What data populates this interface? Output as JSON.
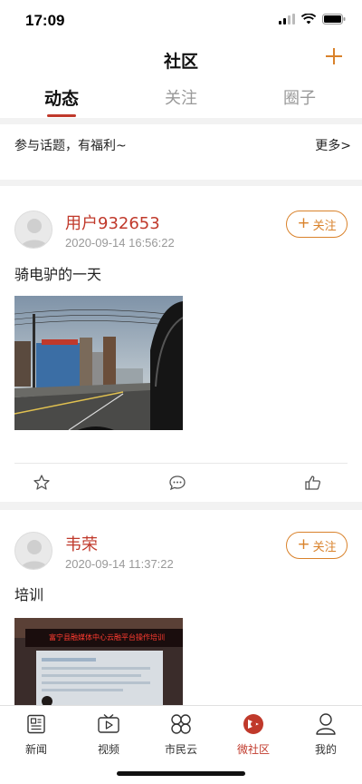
{
  "status_bar": {
    "time": "17:09"
  },
  "nav": {
    "title": "社区",
    "add_icon": "plus-icon"
  },
  "tabs": [
    {
      "label": "动态",
      "active": true
    },
    {
      "label": "关注",
      "active": false
    },
    {
      "label": "圈子",
      "active": false
    }
  ],
  "topic_bar": {
    "text": "参与话题，有福利~",
    "more_label": "更多>"
  },
  "posts": [
    {
      "username": "用户932653",
      "timestamp": "2020-09-14 16:56:22",
      "follow_label": "关注",
      "text": "骑电驴的一天",
      "image": "street-scene-photo"
    },
    {
      "username": "韦荣",
      "timestamp": "2020-09-14 11:37:22",
      "follow_label": "关注",
      "text": "培训",
      "image": "conference-room-photo",
      "banner_text": "富宁县融媒体中心云融平台操作培训"
    }
  ],
  "tabbar": [
    {
      "label": "新闻",
      "icon": "news-icon",
      "active": false
    },
    {
      "label": "视频",
      "icon": "video-icon",
      "active": false
    },
    {
      "label": "市民云",
      "icon": "citizen-cloud-icon",
      "active": false
    },
    {
      "label": "微社区",
      "icon": "community-icon",
      "active": true
    },
    {
      "label": "我的",
      "icon": "profile-icon",
      "active": false
    }
  ],
  "colors": {
    "accent": "#c0392b",
    "follow": "#d9822b",
    "divider": "#f2f2f2"
  }
}
